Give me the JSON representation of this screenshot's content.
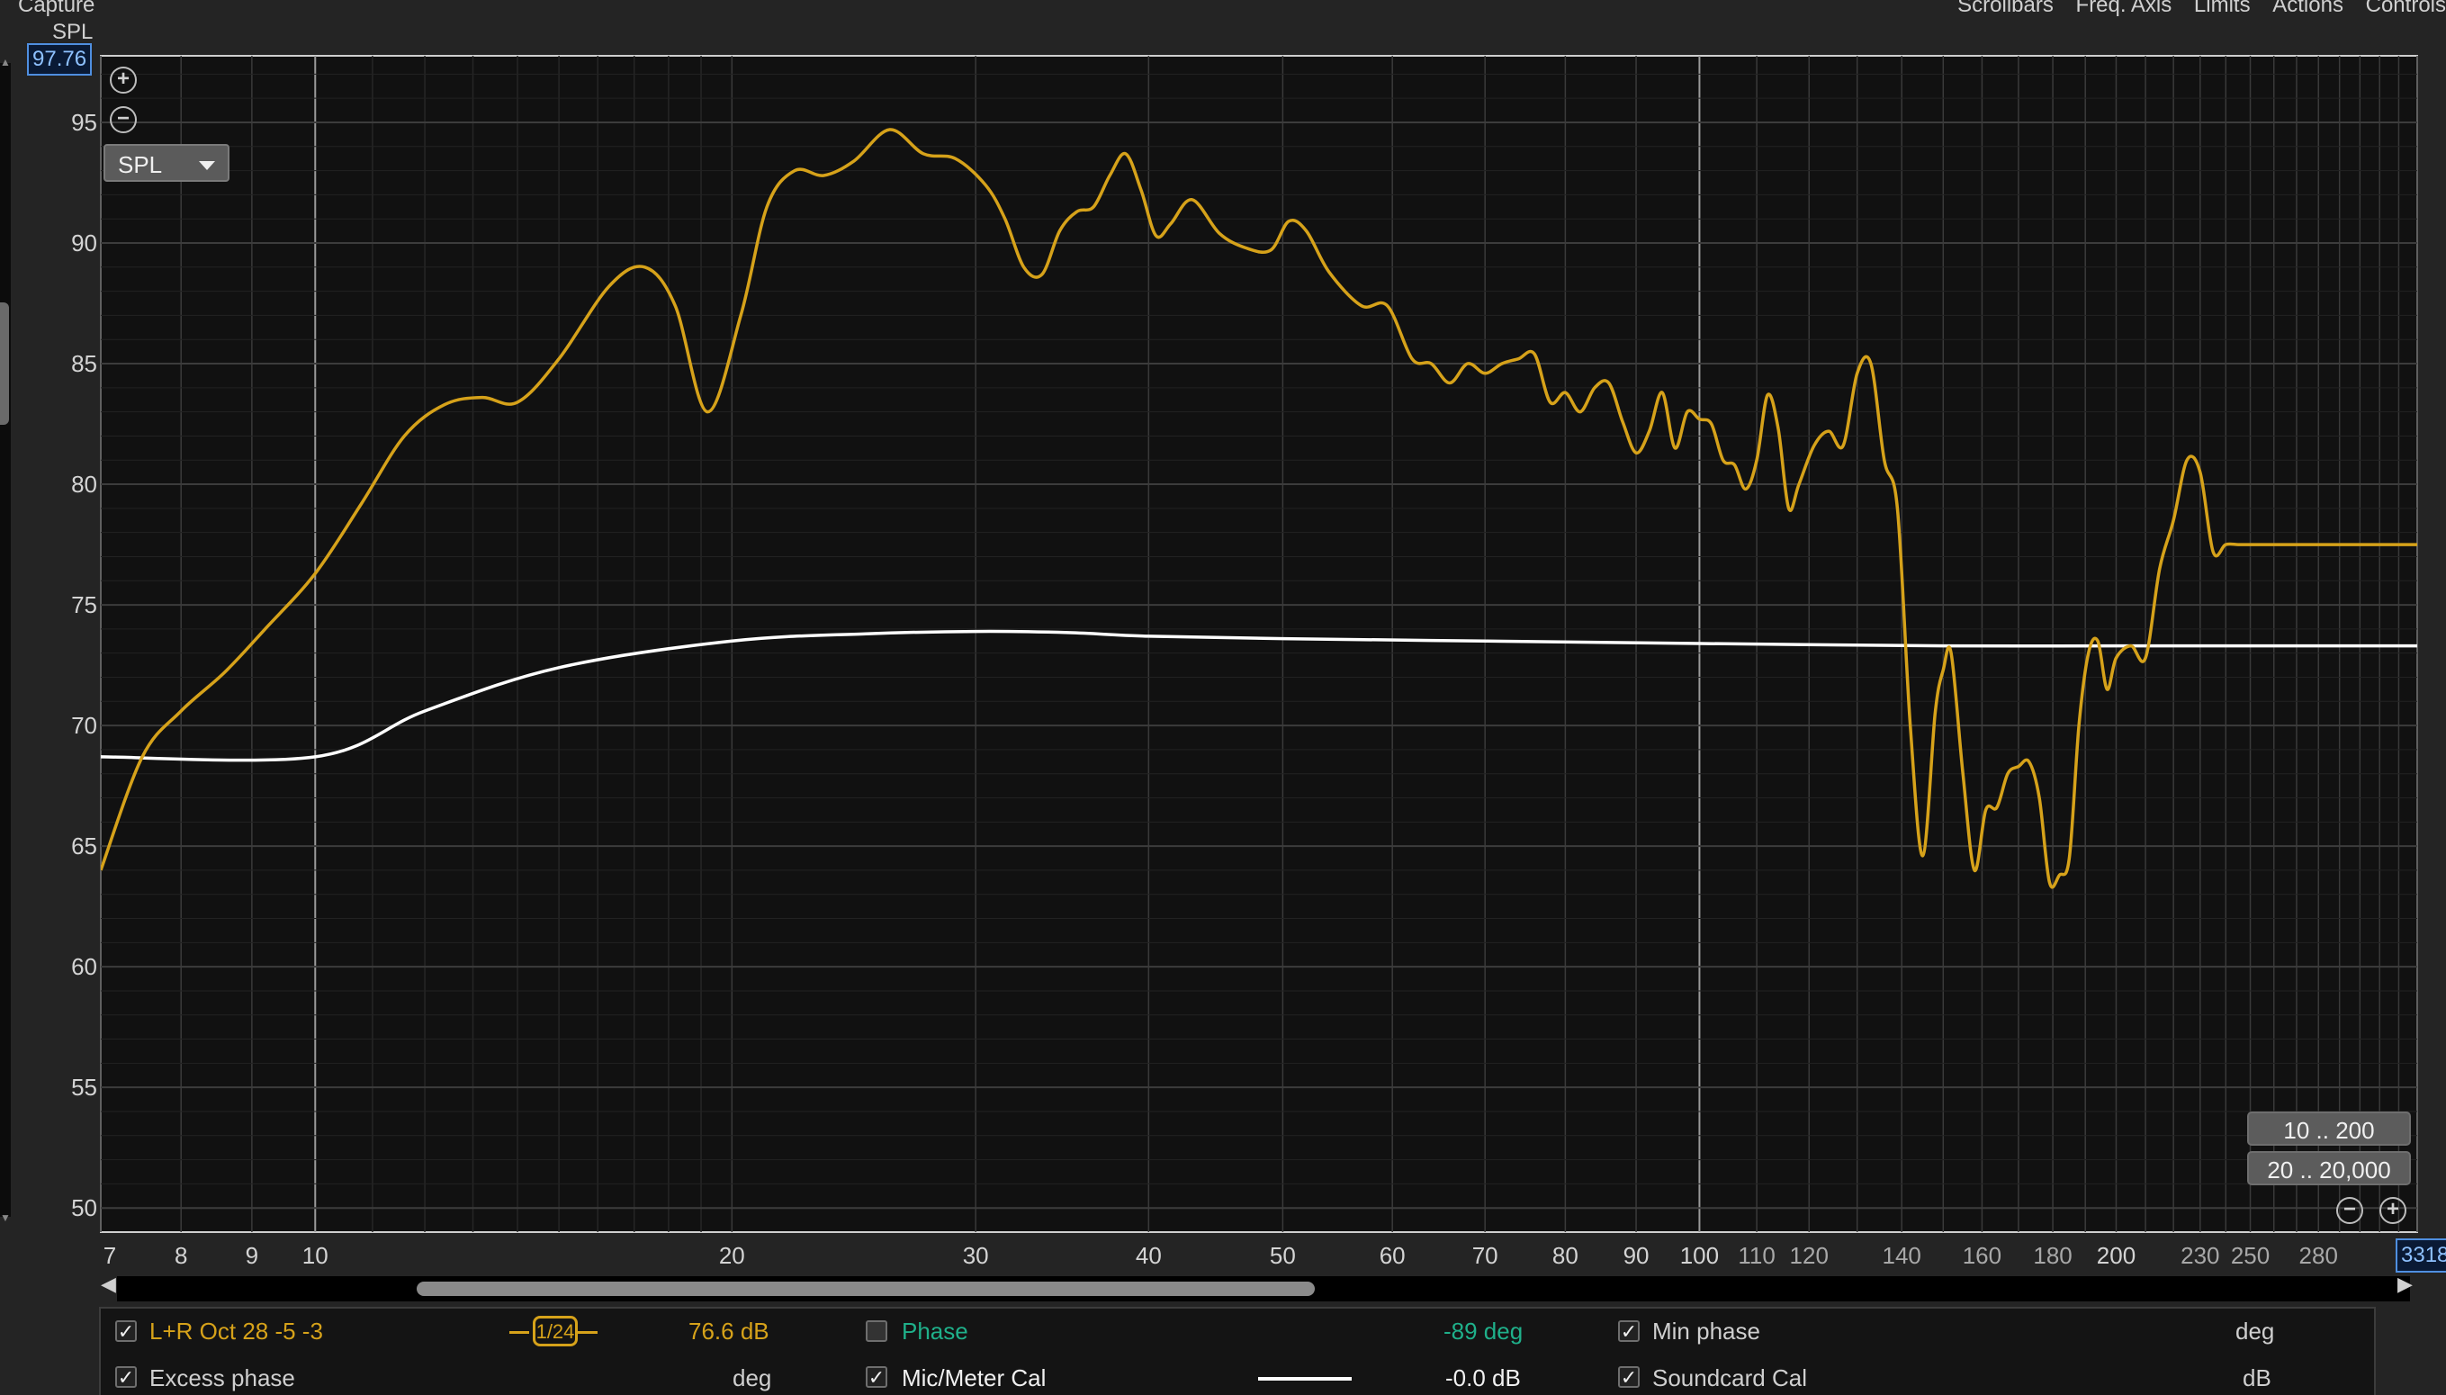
{
  "header": {
    "capture_label": "Capture",
    "menu": [
      "Scrollbars",
      "Freq. Axis",
      "Limits",
      "Actions",
      "Controls"
    ]
  },
  "graph": {
    "y_axis_title": "SPL",
    "y_max_readout": "97.76",
    "x_max_readout": "3318",
    "y_ticks": [
      "95",
      "90",
      "85",
      "80",
      "75",
      "70",
      "65",
      "60",
      "55",
      "50"
    ],
    "x_ticks": [
      {
        "label": "7",
        "major": true
      },
      {
        "label": "8",
        "major": true
      },
      {
        "label": "9",
        "major": true
      },
      {
        "label": "10",
        "major": true
      },
      {
        "label": "20",
        "major": true
      },
      {
        "label": "30",
        "major": true
      },
      {
        "label": "40",
        "major": true
      },
      {
        "label": "50",
        "major": true
      },
      {
        "label": "60",
        "major": true
      },
      {
        "label": "70",
        "major": true
      },
      {
        "label": "80",
        "major": true
      },
      {
        "label": "90",
        "major": true
      },
      {
        "label": "100",
        "major": true
      },
      {
        "label": "110",
        "major": false
      },
      {
        "label": "120",
        "major": false
      },
      {
        "label": "140",
        "major": false
      },
      {
        "label": "160",
        "major": false
      },
      {
        "label": "180",
        "major": false
      },
      {
        "label": "200",
        "major": true
      },
      {
        "label": "230",
        "major": false
      },
      {
        "label": "250",
        "major": false
      },
      {
        "label": "280",
        "major": false
      }
    ],
    "spl_selector": "SPL",
    "range_buttons": [
      "10 .. 200",
      "20 .. 20,000"
    ],
    "colors": {
      "spl_trace": "#d6a21a",
      "mic_cal_trace": "#ffffff",
      "background": "#111111",
      "grid": "#2e2e2e"
    }
  },
  "chart_data": {
    "type": "line",
    "xlabel": "",
    "ylabel": "SPL",
    "x_scale": "log",
    "xlim": [
      7,
      330
    ],
    "ylim": [
      49,
      97.76
    ],
    "grid": true,
    "series": [
      {
        "name": "L+R Oct 28 -5 -3",
        "color": "#d6a21a",
        "x": [
          7,
          7.5,
          8,
          8.6,
          9.2,
          10,
          10.8,
          11.6,
          12.4,
          13.2,
          14.0,
          15.0,
          16.3,
          17.3,
          18.2,
          19.2,
          20.3,
          21.2,
          22.2,
          23.3,
          24.5,
          26.0,
          27.5,
          29.0,
          30.5,
          31.5,
          32.5,
          33.5,
          34.5,
          35.5,
          36.5,
          37.5,
          38.5,
          39.5,
          40.5,
          41.5,
          43,
          45,
          47,
          49,
          50.5,
          52,
          54,
          57,
          59.5,
          62,
          64,
          66,
          68,
          70,
          72,
          74,
          76,
          78,
          80,
          82,
          84,
          86,
          88,
          90,
          92,
          94,
          96,
          98,
          100,
          102,
          104,
          106,
          108,
          110,
          112,
          114,
          116,
          118,
          121,
          124,
          127,
          130,
          133,
          136,
          139,
          142,
          145,
          148,
          150,
          152,
          155,
          158,
          161,
          164,
          167,
          170,
          173,
          176,
          179,
          182,
          185,
          188,
          191,
          194,
          197,
          200,
          205,
          210,
          215,
          220,
          225,
          230,
          235,
          240,
          245,
          250,
          255,
          260,
          265,
          270,
          275,
          280,
          285,
          290,
          295,
          300,
          305,
          310,
          320,
          330
        ],
        "y": [
          64,
          68.7,
          70.6,
          72.2,
          74.0,
          76.3,
          79.2,
          82.0,
          83.3,
          83.6,
          83.4,
          85.2,
          88.2,
          89.0,
          87.4,
          83.0,
          87.0,
          91.5,
          93.0,
          92.8,
          93.4,
          94.7,
          93.7,
          93.5,
          92.4,
          91.0,
          89.0,
          88.7,
          90.5,
          91.3,
          91.5,
          92.8,
          93.7,
          92.2,
          90.3,
          90.8,
          91.8,
          90.4,
          89.8,
          89.7,
          90.9,
          90.5,
          88.8,
          87.4,
          87.4,
          85.2,
          85.0,
          84.2,
          85.0,
          84.6,
          85.0,
          85.2,
          85.4,
          83.4,
          83.8,
          83.0,
          84.0,
          84.2,
          82.6,
          81.3,
          82.2,
          83.8,
          81.5,
          83.0,
          82.7,
          82.5,
          81.0,
          80.8,
          79.8,
          81.0,
          83.7,
          82.3,
          79.0,
          80.0,
          81.6,
          82.2,
          81.6,
          84.6,
          85.0,
          81.0,
          79.0,
          70.0,
          64.6,
          70.5,
          72.3,
          73.0,
          68.0,
          64.0,
          66.5,
          66.6,
          68.0,
          68.3,
          68.5,
          67.0,
          63.5,
          63.8,
          64.5,
          70.0,
          73.0,
          73.5,
          71.5,
          72.8,
          73.3,
          72.8,
          76.5,
          78.5,
          81.0,
          80.5,
          77.2,
          77.5,
          77.5,
          77.5,
          77.5,
          77.5,
          77.5,
          77.5,
          77.5,
          77.5,
          77.5,
          77.5,
          77.5,
          77.5,
          77.5,
          77.5,
          77.5,
          77.5
        ]
      },
      {
        "name": "Mic/Meter Cal",
        "color": "#ffffff",
        "x": [
          7,
          10,
          12,
          15,
          20,
          25,
          30,
          35,
          40,
          50,
          70,
          100,
          150,
          200,
          330
        ],
        "y": [
          68.7,
          68.7,
          70.6,
          72.4,
          73.5,
          73.8,
          73.9,
          73.85,
          73.7,
          73.6,
          73.5,
          73.4,
          73.3,
          73.3,
          73.3
        ]
      }
    ]
  },
  "legend_panel": {
    "row1": {
      "trace_name": "L+R Oct 28 -5 -3",
      "smoothing": "1/24",
      "trace_value": "76.6 dB",
      "phase_label": "Phase",
      "phase_value": "-89 deg",
      "min_phase_label": "Min phase",
      "min_phase_unit": "deg"
    },
    "row2": {
      "excess_phase_label": "Excess phase",
      "excess_phase_unit": "deg",
      "mic_cal_label": "Mic/Meter Cal",
      "mic_cal_value": "-0.0 dB",
      "soundcard_cal_label": "Soundcard Cal",
      "soundcard_cal_unit": "dB"
    }
  }
}
